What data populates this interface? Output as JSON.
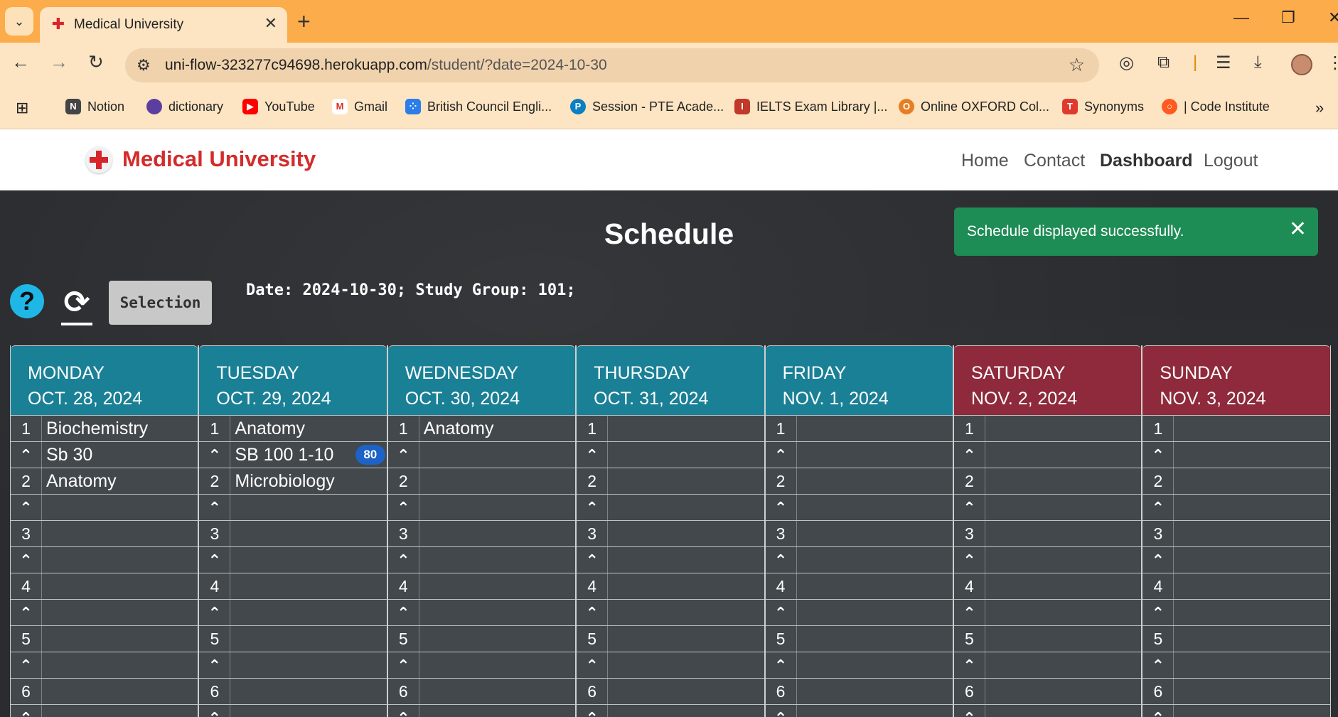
{
  "browser": {
    "tab_title": "Medical University",
    "url_host": "uni-flow-323277c94698.herokuapp.com",
    "url_path": "/student/?date=2024-10-30",
    "bookmarks": [
      {
        "label": "Notion",
        "color": "#444444"
      },
      {
        "label": "dictionary",
        "color": "#5b3fa0"
      },
      {
        "label": "YouTube",
        "color": "#ff0000"
      },
      {
        "label": "Gmail",
        "color": "#d93025"
      },
      {
        "label": "British Council Engli...",
        "color": "#2b7de9"
      },
      {
        "label": "Session - PTE Acade...",
        "color": "#0a7fc2"
      },
      {
        "label": "IELTS Exam Library |...",
        "color": "#c0392b"
      },
      {
        "label": "Online OXFORD Col...",
        "color": "#e67e22"
      },
      {
        "label": "Synonyms",
        "color": "#e03a2f"
      },
      {
        "label": "| Code Institute",
        "color": "#ff5a1f"
      }
    ]
  },
  "site": {
    "brand": "Medical University",
    "nav": [
      "Home",
      "Contact",
      "Dashboard",
      "Logout"
    ],
    "active_nav": "Dashboard"
  },
  "page": {
    "title": "Schedule",
    "toast": "Schedule displayed successfully.",
    "selection_label": "Selection",
    "info": "Date: 2024-10-30; Study Group: 101;"
  },
  "schedule": {
    "days": [
      {
        "name": "MONDAY",
        "date": "OCT. 28, 2024",
        "weekend": false,
        "lessons": [
          {
            "num": "1",
            "subject": "Biochemistry",
            "room": "Sb 30",
            "count": ""
          },
          {
            "num": "2",
            "subject": "Anatomy",
            "room": "",
            "count": ""
          },
          {
            "num": "3",
            "subject": "",
            "room": "",
            "count": ""
          },
          {
            "num": "4",
            "subject": "",
            "room": "",
            "count": ""
          },
          {
            "num": "5",
            "subject": "",
            "room": "",
            "count": ""
          },
          {
            "num": "6",
            "subject": "",
            "room": "",
            "count": ""
          }
        ]
      },
      {
        "name": "TUESDAY",
        "date": "OCT. 29, 2024",
        "weekend": false,
        "lessons": [
          {
            "num": "1",
            "subject": "Anatomy",
            "room": "SB 100 1-10",
            "count": "80"
          },
          {
            "num": "2",
            "subject": "Microbiology",
            "room": "",
            "count": ""
          },
          {
            "num": "3",
            "subject": "",
            "room": "",
            "count": ""
          },
          {
            "num": "4",
            "subject": "",
            "room": "",
            "count": ""
          },
          {
            "num": "5",
            "subject": "",
            "room": "",
            "count": ""
          },
          {
            "num": "6",
            "subject": "",
            "room": "",
            "count": ""
          }
        ]
      },
      {
        "name": "WEDNESDAY",
        "date": "OCT. 30, 2024",
        "weekend": false,
        "lessons": [
          {
            "num": "1",
            "subject": "Anatomy",
            "room": "",
            "count": ""
          },
          {
            "num": "2",
            "subject": "",
            "room": "",
            "count": ""
          },
          {
            "num": "3",
            "subject": "",
            "room": "",
            "count": ""
          },
          {
            "num": "4",
            "subject": "",
            "room": "",
            "count": ""
          },
          {
            "num": "5",
            "subject": "",
            "room": "",
            "count": ""
          },
          {
            "num": "6",
            "subject": "",
            "room": "",
            "count": ""
          }
        ]
      },
      {
        "name": "THURSDAY",
        "date": "OCT. 31, 2024",
        "weekend": false,
        "lessons": [
          {
            "num": "1",
            "subject": "",
            "room": "",
            "count": ""
          },
          {
            "num": "2",
            "subject": "",
            "room": "",
            "count": ""
          },
          {
            "num": "3",
            "subject": "",
            "room": "",
            "count": ""
          },
          {
            "num": "4",
            "subject": "",
            "room": "",
            "count": ""
          },
          {
            "num": "5",
            "subject": "",
            "room": "",
            "count": ""
          },
          {
            "num": "6",
            "subject": "",
            "room": "",
            "count": ""
          }
        ]
      },
      {
        "name": "FRIDAY",
        "date": "NOV. 1, 2024",
        "weekend": false,
        "lessons": [
          {
            "num": "1",
            "subject": "",
            "room": "",
            "count": ""
          },
          {
            "num": "2",
            "subject": "",
            "room": "",
            "count": ""
          },
          {
            "num": "3",
            "subject": "",
            "room": "",
            "count": ""
          },
          {
            "num": "4",
            "subject": "",
            "room": "",
            "count": ""
          },
          {
            "num": "5",
            "subject": "",
            "room": "",
            "count": ""
          },
          {
            "num": "6",
            "subject": "",
            "room": "",
            "count": ""
          }
        ]
      },
      {
        "name": "SATURDAY",
        "date": "NOV. 2, 2024",
        "weekend": true,
        "lessons": [
          {
            "num": "1",
            "subject": "",
            "room": "",
            "count": ""
          },
          {
            "num": "2",
            "subject": "",
            "room": "",
            "count": ""
          },
          {
            "num": "3",
            "subject": "",
            "room": "",
            "count": ""
          },
          {
            "num": "4",
            "subject": "",
            "room": "",
            "count": ""
          },
          {
            "num": "5",
            "subject": "",
            "room": "",
            "count": ""
          },
          {
            "num": "6",
            "subject": "",
            "room": "",
            "count": ""
          }
        ]
      },
      {
        "name": "SUNDAY",
        "date": "NOV. 3, 2024",
        "weekend": true,
        "lessons": [
          {
            "num": "1",
            "subject": "",
            "room": "",
            "count": ""
          },
          {
            "num": "2",
            "subject": "",
            "room": "",
            "count": ""
          },
          {
            "num": "3",
            "subject": "",
            "room": "",
            "count": ""
          },
          {
            "num": "4",
            "subject": "",
            "room": "",
            "count": ""
          },
          {
            "num": "5",
            "subject": "",
            "room": "",
            "count": ""
          },
          {
            "num": "6",
            "subject": "",
            "room": "",
            "count": ""
          }
        ]
      }
    ]
  },
  "icons": {
    "help": "question-circle-icon",
    "refresh": "refresh-icon",
    "toggle": "chevron-up-icon",
    "logo": "red-cross-icon"
  },
  "colors": {
    "weekday_header": "#1a8096",
    "weekend_header": "#8e2a3b",
    "brand": "#d42b2b",
    "toast": "#1e8c55",
    "badge": "#1d62c7"
  }
}
